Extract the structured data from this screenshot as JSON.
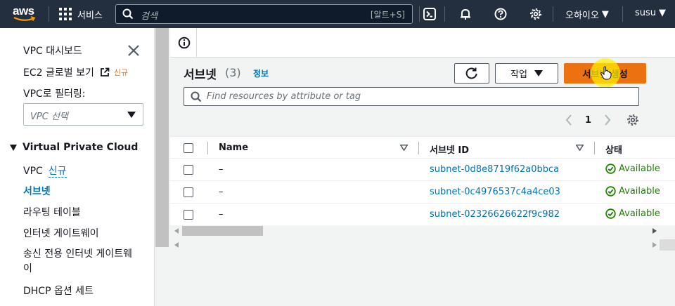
{
  "topnav": {
    "logo_text": "aws",
    "services_label": "서비스",
    "search_placeholder": "검색",
    "search_shortcut": "[알트+S]",
    "region_label": "오하이오",
    "user_label": "susu"
  },
  "sidebar": {
    "dashboard": "VPC 대시보드",
    "global_view": "EC2 글로벌 보기",
    "global_view_badge": "신규",
    "filter_label": "VPC로 필터링:",
    "vpc_select_placeholder": "VPC 선택",
    "section_title": "Virtual Private Cloud",
    "items": [
      {
        "label": "VPC",
        "badge": "신규"
      },
      {
        "label": "서브넷"
      },
      {
        "label": "라우팅 테이블"
      },
      {
        "label": "인터넷 게이트웨이"
      },
      {
        "label": "송신 전용 인터넷 게이트웨이"
      },
      {
        "label": "DHCP 옵션 세트"
      }
    ]
  },
  "main": {
    "title": "서브넷",
    "count": "(3)",
    "info_link": "정보",
    "actions_label": "작업",
    "create_label": "서브넷 생성",
    "filter_placeholder": "Find resources by attribute or tag",
    "page_number": "1"
  },
  "table": {
    "columns": [
      "Name",
      "서브넷 ID",
      "상태"
    ],
    "rows": [
      {
        "name": "–",
        "subnet_id": "subnet-0d8e8719f62a0bbca",
        "status": "Available"
      },
      {
        "name": "–",
        "subnet_id": "subnet-0c4976537c4a4ce03",
        "status": "Available"
      },
      {
        "name": "–",
        "subnet_id": "subnet-02326626622f9c982",
        "status": "Available"
      }
    ]
  },
  "colors": {
    "nav_bg": "#232f3e",
    "accent_orange": "#ec7211",
    "link_blue": "#0073bb",
    "status_green": "#1d8102"
  }
}
